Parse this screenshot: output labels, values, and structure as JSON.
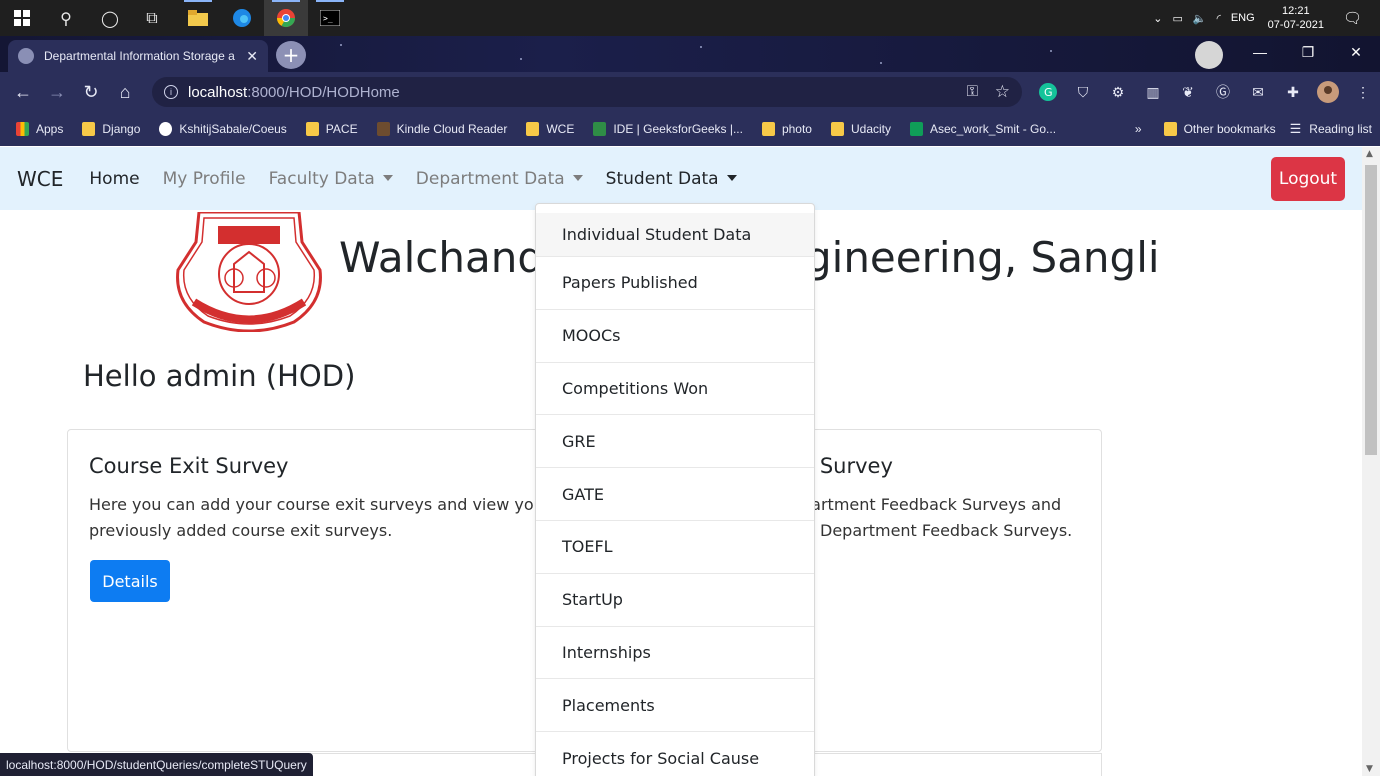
{
  "taskbar": {
    "clock_time": "12:21",
    "clock_date": "07-07-2021",
    "lang": "ENG"
  },
  "browser": {
    "tab_title": "Departmental Information Storage a",
    "url_host": "localhost",
    "url_rest": ":8000/HOD/HODHome",
    "status_url": "localhost:8000/HOD/studentQueries/completeSTUQuery"
  },
  "bookmarks": {
    "items": [
      "Apps",
      "Django",
      "KshitijSabale/Coeus",
      "PACE",
      "Kindle Cloud Reader",
      "WCE",
      "IDE | GeeksforGeeks |...",
      "photo",
      "Udacity",
      "Asec_work_Smit - Go..."
    ],
    "more": "»",
    "other": "Other bookmarks",
    "reading_list": "Reading list"
  },
  "navbar": {
    "brand": "WCE",
    "home": "Home",
    "my_profile": "My Profile",
    "faculty_data": "Faculty Data",
    "department_data": "Department Data",
    "student_data": "Student Data",
    "logout": "Logout"
  },
  "header": {
    "college_left": "Walchand",
    "college_right": "gineering, Sangli"
  },
  "greeting": "Hello admin (HOD)",
  "cards": {
    "left_title": "Course Exit Survey",
    "left_text_1": "Here you can add your course exit surveys and view your",
    "left_text_2": "previously added course exit surveys.",
    "left_button": "Details",
    "right_title": "k Survey",
    "right_text_1": "partment Feedback Surveys and",
    "right_text_2": "Department Feedback Surveys."
  },
  "dropdown": {
    "items": [
      "Individual Student Data",
      "Papers Published",
      "MOOCs",
      "Competitions Won",
      "GRE",
      "GATE",
      "TOEFL",
      "StartUp",
      "Internships",
      "Placements",
      "Projects for Social Cause"
    ]
  },
  "colors": {
    "navbar_bg": "#e3f2fd",
    "logout_bg": "#dc3545",
    "primary_btn": "#0d7cf2",
    "logo_red": "#d32f2f"
  }
}
